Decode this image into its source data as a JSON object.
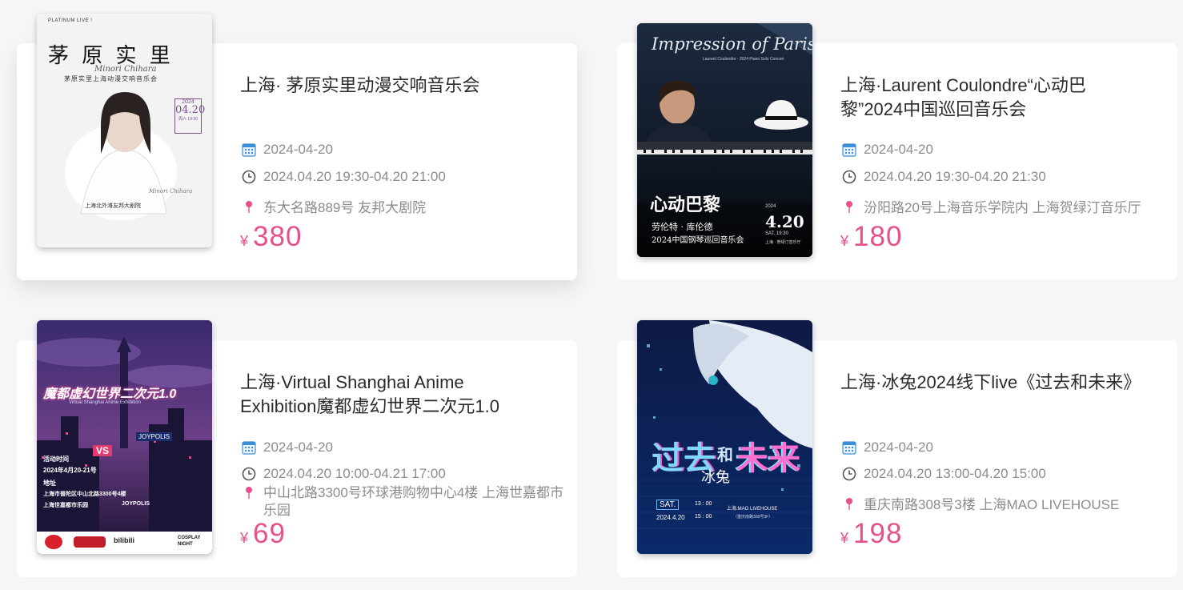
{
  "colors": {
    "accent": "#e8508b",
    "meta_text": "#8c8c8c",
    "title_text": "#2b2b2b"
  },
  "events": [
    {
      "title": "上海· 茅原实里动漫交响音乐会",
      "date": "2024-04-20",
      "time": "2024.04.20 19:30-04.20 21:00",
      "location": "东大名路889号 友邦大剧院",
      "currency": "¥",
      "price": "380",
      "poster": {
        "top_label": "PLATINUM LIVE !",
        "name": "茅 原 实 里",
        "script": "Minori Chihara",
        "subtitle": "茅原实里上海动漫交响音乐会",
        "year": "2024",
        "date_big": "04.20",
        "weekday": "周六 19:30",
        "signature": "Minori Chihara",
        "venue": "上海北外滩友邦大剧院"
      }
    },
    {
      "title": "上海·Laurent Coulondre“心动巴黎”2024中国巡回音乐会",
      "date": "2024-04-20",
      "time": "2024.04.20 19:30-04.20 21:30",
      "location": "汾阳路20号上海音乐学院内 上海贺绿汀音乐厅",
      "currency": "¥",
      "price": "180",
      "poster": {
        "script": "Impression of Paris",
        "sub": "Laurent Coulondre · 2024 Piano Solo Concert",
        "name": "心动巴黎",
        "artist": "劳伦特 · 库伦德",
        "tour": "2024中国钢琴巡回音乐会",
        "year": "2024",
        "date_big": "4.20",
        "weekday": "SAT. 19:30",
        "venue": "上海 · 贺绿汀音乐厅"
      }
    },
    {
      "title": "上海·Virtual Shanghai Anime Exhibition魔都虚幻世界二次元1.0",
      "date": "2024-04-20",
      "time": "2024.04.20 10:00-04.21 17:00",
      "location": "中山北路3300号环球港购物中心4楼 上海世嘉都市乐园",
      "currency": "¥",
      "price": "69",
      "poster": {
        "headline": "魔都虚幻世界二次元1.0",
        "sub": "Virtual Shanghai Anime Exhibition",
        "brand": "JOYPOLIS",
        "vs": "VS",
        "l1": "活动时间",
        "l2": "2024年4月20-21号",
        "l3": "地址",
        "l4": "上海市普陀区中山北路3300号4楼",
        "l5": "上海世嘉都市乐园",
        "brand2": "JOYPOLIS",
        "logo1": "bilibili",
        "logo2": "COSPLAY NIGHT"
      }
    },
    {
      "title": "上海·冰兔2024线下live《过去和未来》",
      "date": "2024-04-20",
      "time": "2024.04.20 13:00-04.20 15:00",
      "location": "重庆南路308号3楼 上海MAO LIVEHOUSE",
      "currency": "¥",
      "price": "198",
      "poster": {
        "headline1": "过去",
        "headline2": "和",
        "headline3": "未来",
        "artist": "冰兔",
        "day": "SAT.",
        "date": "2024.4.20",
        "t1": "13 : 00",
        "t2": "15 : 00",
        "venue": "上海.MAO LIVEHOUSE",
        "venue2": "（重庆南路308号3F）"
      }
    }
  ]
}
